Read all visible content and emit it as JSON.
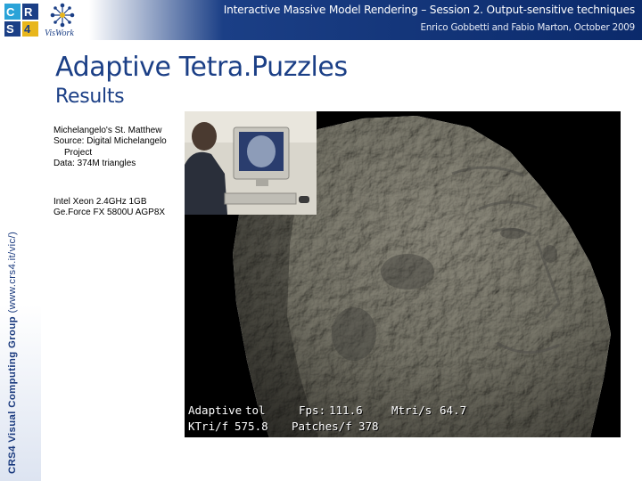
{
  "header": {
    "title": "Interactive Massive Model Rendering – Session 2. Output-sensitive techniques",
    "subtitle": "Enrico Gobbetti and Fabio Marton, October 2009",
    "logo_crs4": "crs4-logo",
    "logo_viswork": "viswork-logo",
    "logo_viswork_text": "VisWork"
  },
  "sidebar": {
    "org_bold": "CRS4 Visual Computing Group",
    "org_url": " (www.crs4.it/vic/)"
  },
  "slide": {
    "title": "Adaptive Tetra.Puzzles",
    "subtitle": "Results",
    "description": [
      "Michelangelo's St. Matthew",
      "Source: Digital Michelangelo",
      "Project",
      "Data: 374M triangles"
    ],
    "hardware": [
      "Intel Xeon 2.4GHz 1GB",
      "Ge.Force FX 5800U AGP8X"
    ]
  },
  "render": {
    "hud": {
      "mode_label": "Adaptive",
      "tol_label": "tol",
      "fps_label": "Fps:",
      "fps_value": "111.6",
      "mtri_label": "Mtri/s",
      "mtri_value": "64.7",
      "ktri_label": "KTri/f",
      "ktri_value": "575.8",
      "patches_label": "Patches/f",
      "patches_value": "378"
    }
  },
  "colors": {
    "brand_blue": "#1b3f86",
    "statue_gray": "#9a9990"
  }
}
